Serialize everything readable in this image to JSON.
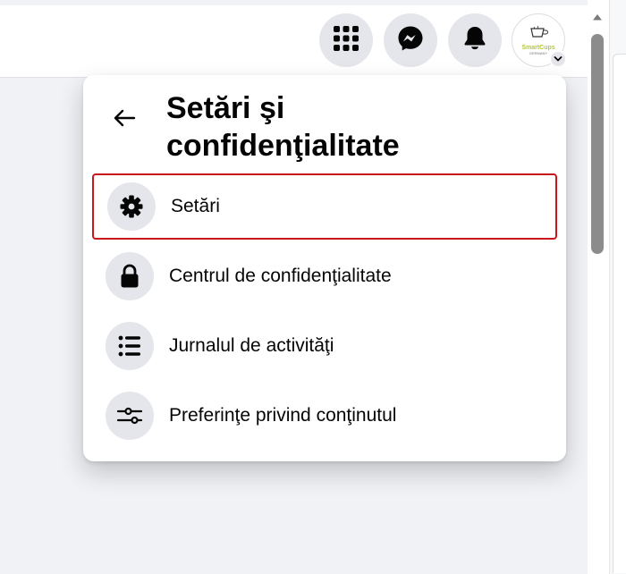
{
  "avatar": {
    "brand": "SmartCups",
    "sub": "GERMANY"
  },
  "menu": {
    "title_line1": "Setări şi",
    "title_line2": "confidenţialitate",
    "items": [
      {
        "label": "Setări",
        "icon": "gear-icon",
        "selected": true
      },
      {
        "label": "Centrul de confidenţialitate",
        "icon": "lock-icon",
        "selected": false
      },
      {
        "label": "Jurnalul de activităţi",
        "icon": "list-icon",
        "selected": false
      },
      {
        "label": "Preferinţe privind conţinutul",
        "icon": "sliders-icon",
        "selected": false
      }
    ]
  },
  "colors": {
    "selection_outline": "#c8161d",
    "icon_background": "#e4e6eb",
    "page_background": "#f0f2f5"
  }
}
